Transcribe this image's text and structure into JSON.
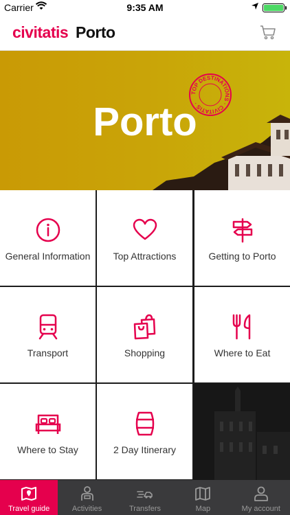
{
  "status_bar": {
    "carrier": "Carrier",
    "time": "9:35 AM"
  },
  "header": {
    "brand": "civitatis",
    "city": "Porto",
    "cart_icon": "cart-icon"
  },
  "hero": {
    "title": "Porto",
    "stamp_text": "TOP DESTINATIONS · CIVITATIS ·"
  },
  "menu": [
    {
      "label": "General Information",
      "icon": "info-icon"
    },
    {
      "label": "Top Attractions",
      "icon": "heart-icon"
    },
    {
      "label": "Getting to Porto",
      "icon": "signpost-icon"
    },
    {
      "label": "Transport",
      "icon": "train-icon"
    },
    {
      "label": "Shopping",
      "icon": "shopping-bags-icon"
    },
    {
      "label": "Where to Eat",
      "icon": "fork-knife-icon"
    },
    {
      "label": "Where to Stay",
      "icon": "bed-icon"
    },
    {
      "label": "2 Day Itinerary",
      "icon": "barrel-icon"
    }
  ],
  "tabbar": [
    {
      "label": "Travel guide",
      "icon": "map-book-icon",
      "active": true
    },
    {
      "label": "Activities",
      "icon": "guide-person-icon",
      "active": false
    },
    {
      "label": "Transfers",
      "icon": "transfer-car-icon",
      "active": false
    },
    {
      "label": "Map",
      "icon": "map-icon",
      "active": false
    },
    {
      "label": "My account",
      "icon": "user-icon",
      "active": false
    }
  ],
  "colors": {
    "accent": "#e5004d",
    "hero": "#c9a408",
    "tabbar": "#3a3a3c"
  }
}
